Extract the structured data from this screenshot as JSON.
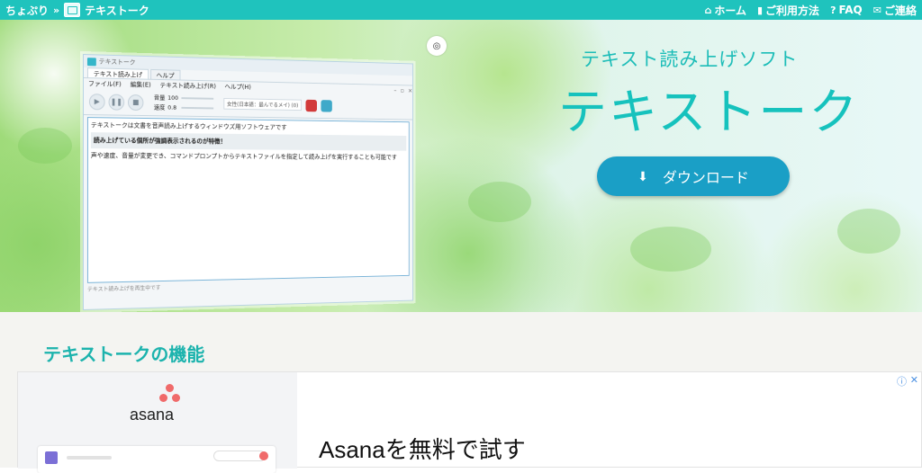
{
  "topbar": {
    "site_name": "ちょぷり",
    "separator": "»",
    "page_name": "テキストーク",
    "nav": [
      {
        "label": "ホーム",
        "icon": "home-icon"
      },
      {
        "label": "ご利用方法",
        "icon": "book-icon"
      },
      {
        "label": "FAQ",
        "icon": "question-icon"
      },
      {
        "label": "ご連絡",
        "icon": "mail-icon"
      }
    ]
  },
  "hero": {
    "subtitle": "テキスト読み上げソフト",
    "title": "テキストーク",
    "download_label": "ダウンロード",
    "screenshot": {
      "window_title": "テキストーク",
      "tabs": [
        "テキスト読み上げ",
        "ヘルプ"
      ],
      "menu": [
        "ファイル(F)",
        "編集(E)",
        "テキスト読み上げ(R)",
        "ヘルプ(H)"
      ],
      "volume_label": "音量",
      "volume_value": "100",
      "speed_label": "速度",
      "speed_value": "0.8",
      "voice_select": "女性(日本語：最んでるメイ) (0)",
      "doc_line1": "テキストークは文書を音声読み上げするウィンドウズ用ソフトウェアです",
      "doc_highlight": "読み上げている個所が強調表示されるのが特徴！",
      "doc_line3": "声や速度、音量が変更でき、コマンドプロンプトからテキストファイルを指定して読み上げを実行することも可能です",
      "status": "テキスト読み上げを再生中です"
    }
  },
  "section": {
    "heading": "テキストークの機能"
  },
  "ad": {
    "brand": "asana",
    "headline": "Asanaを無料で試す",
    "info_icon": "ⓘ",
    "close_icon": "✕"
  },
  "colors": {
    "accent": "#1fc3bd",
    "button": "#1a9fc6",
    "asana": "#f06a6a"
  }
}
